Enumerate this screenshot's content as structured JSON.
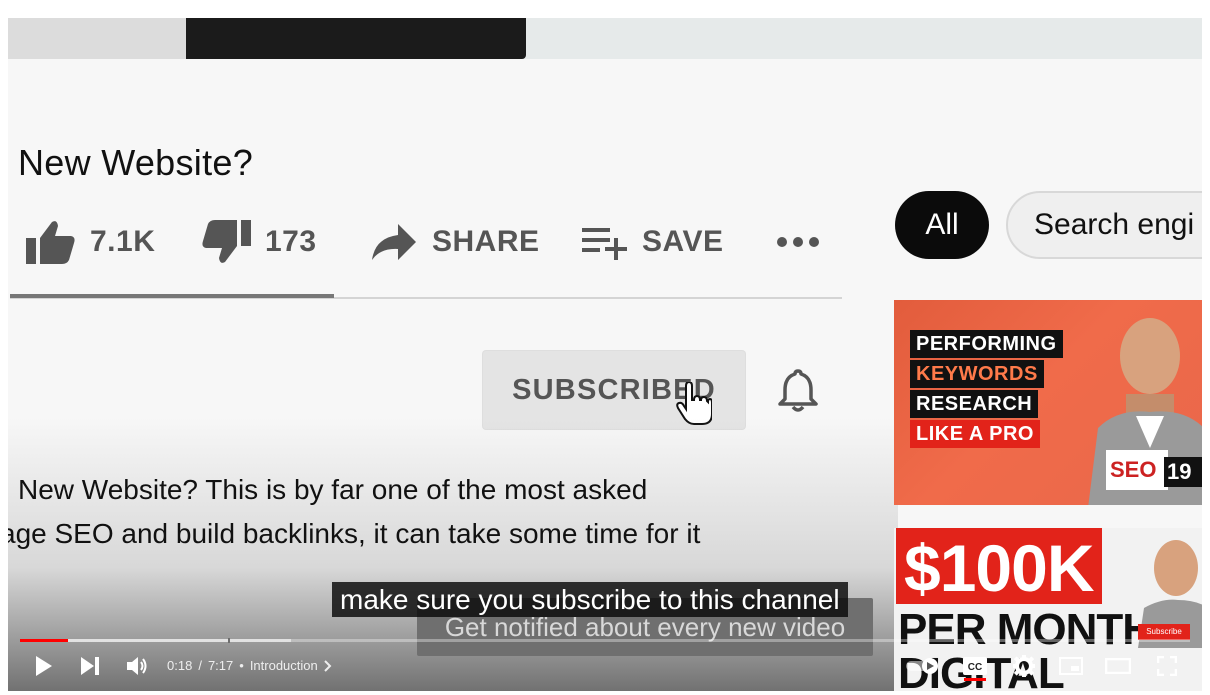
{
  "video": {
    "title": "New Website?",
    "likes": "7.1K",
    "dislikes": "173",
    "share_label": "SHARE",
    "save_label": "SAVE",
    "subscribed_label": "SUBSCRIBED",
    "description_line1": "New Website? This is by far one of the most asked",
    "description_line2": "age SEO and build backlinks, it can take some time for it",
    "notify_text": "Get notified about every new video"
  },
  "chips": {
    "all": "All",
    "search": "Search engi"
  },
  "thumbnails": [
    {
      "lines": [
        "PERFORMING",
        "KEYWORDS",
        "RESEARCH",
        "LIKE A PRO"
      ],
      "badge": "SEO",
      "duration": "19"
    },
    {
      "headline": "$100K",
      "line2": "PER MONTH",
      "line3": "DIGITAL",
      "mini_subscribe": "Subscribe"
    }
  ],
  "caption": "make sure you subscribe to this channel",
  "player": {
    "current_time": "0:18",
    "separator": "/",
    "duration": "7:17",
    "bullet": "•",
    "chapter": "Introduction",
    "progress_fraction": 0.041,
    "buffer_fraction": 0.232,
    "accent_color": "#ff0000"
  }
}
